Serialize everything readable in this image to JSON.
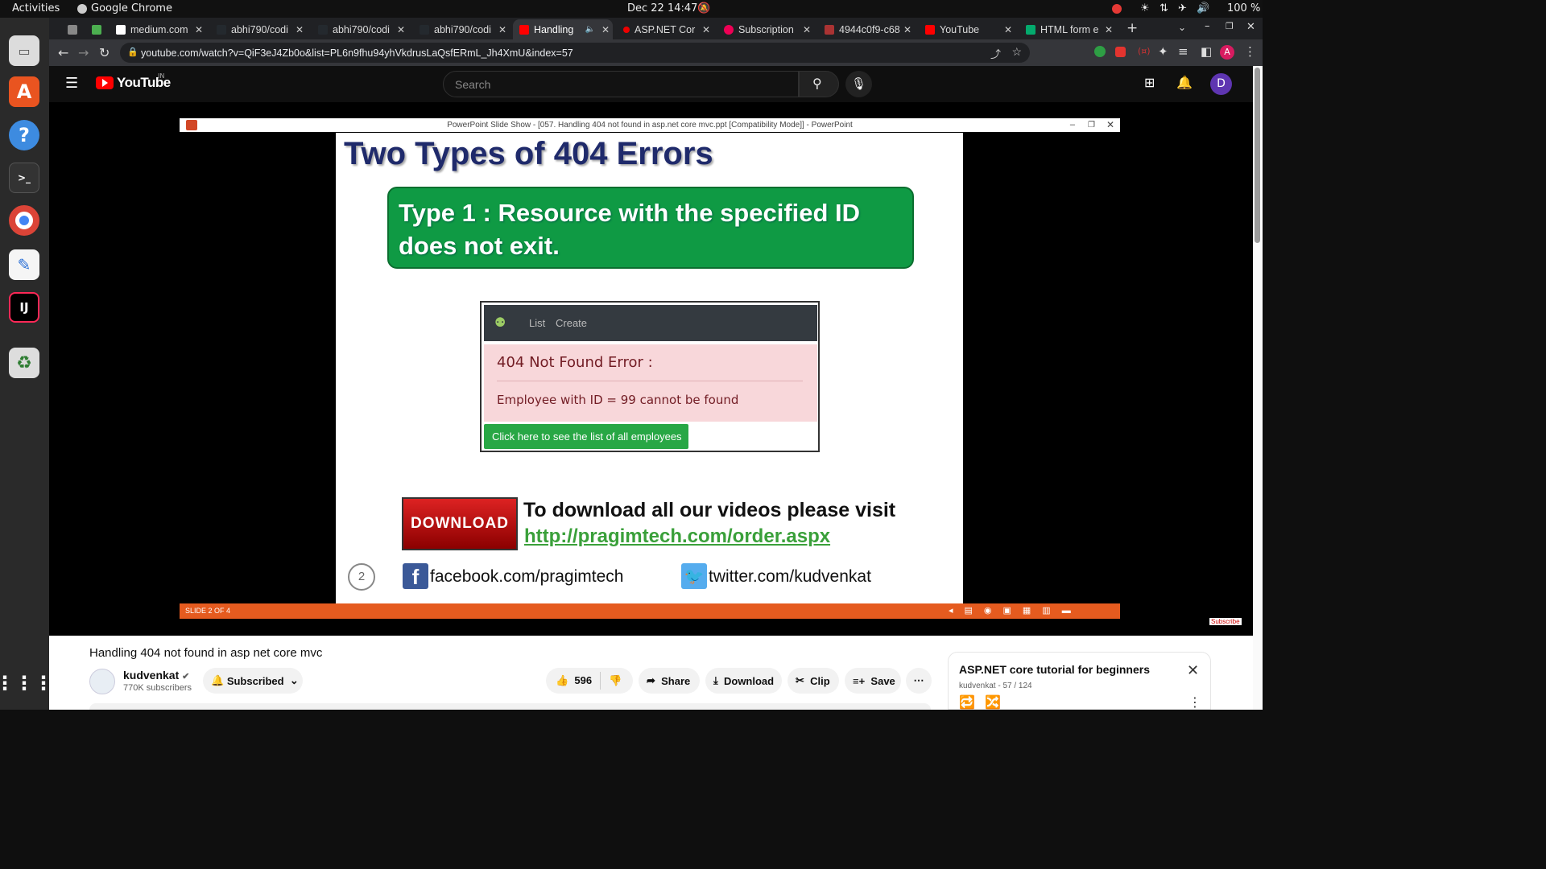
{
  "topbar": {
    "activities": "Activities",
    "app": "Google Chrome",
    "datetime": "Dec 22  14:47",
    "battery": "100 %"
  },
  "tabs": [
    {
      "label": "",
      "color": "#888"
    },
    {
      "label": "",
      "color": "#4caf50"
    },
    {
      "label": "medium.com",
      "color": "#fff"
    },
    {
      "label": "abhi790/codi",
      "color": "#24292e"
    },
    {
      "label": "abhi790/codi",
      "color": "#24292e"
    },
    {
      "label": "abhi790/codi",
      "color": "#24292e"
    },
    {
      "label": "Handling",
      "color": "#ff0000"
    },
    {
      "label": "ASP.NET Cor",
      "color": "#e00"
    },
    {
      "label": "Subscription",
      "color": "#e05"
    },
    {
      "label": "4944c0f9-c68",
      "color": "#a33"
    },
    {
      "label": "YouTube",
      "color": "#ff0000"
    },
    {
      "label": "HTML form e",
      "color": "#04aa6d"
    }
  ],
  "address": {
    "url": "youtube.com/watch?v=QiF3eJ4Zb0o&list=PL6n9fhu94yhVkdrusLaQsfERmL_Jh4XmU&index=57",
    "profile": "A"
  },
  "youtube": {
    "logo": "YouTube",
    "region": "IN",
    "search_placeholder": "Search",
    "avatar": "D"
  },
  "ppt": {
    "window_title": "PowerPoint Slide Show - [057. Handling 404 not found in asp.net core mvc.ppt [Compatibility Mode]] - PowerPoint",
    "slide_title": "Two Types of 404 Errors",
    "type1_line1": "Type 1 : Resource with the specified ID",
    "type1_line2": "does not exit.",
    "nav_list": "List",
    "nav_create": "Create",
    "error_heading": "404 Not Found Error :",
    "error_message": "Employee with ID = 99 cannot be found",
    "button_text": "Click here to see the list of all employees",
    "download_badge": "DOWNLOAD",
    "download_text": "To download all our videos please visit",
    "download_link": "http://pragimtech.com/order.aspx",
    "slide_number": "2",
    "facebook": "facebook.com/pragimtech",
    "twitter": "twitter.com/kudvenkat",
    "status": "SLIDE 2 OF 4",
    "subscribe_badge": "Subscribe"
  },
  "video": {
    "title": "Handling 404 not found in asp net core mvc",
    "channel": "kudvenkat",
    "subscribers": "770K subscribers",
    "subscribed_label": "Subscribed",
    "likes": "596",
    "share": "Share",
    "download": "Download",
    "clip": "Clip",
    "save": "Save"
  },
  "playlist": {
    "title": "ASP.NET core tutorial for beginners",
    "meta": "kudvenkat - 57 / 124"
  }
}
